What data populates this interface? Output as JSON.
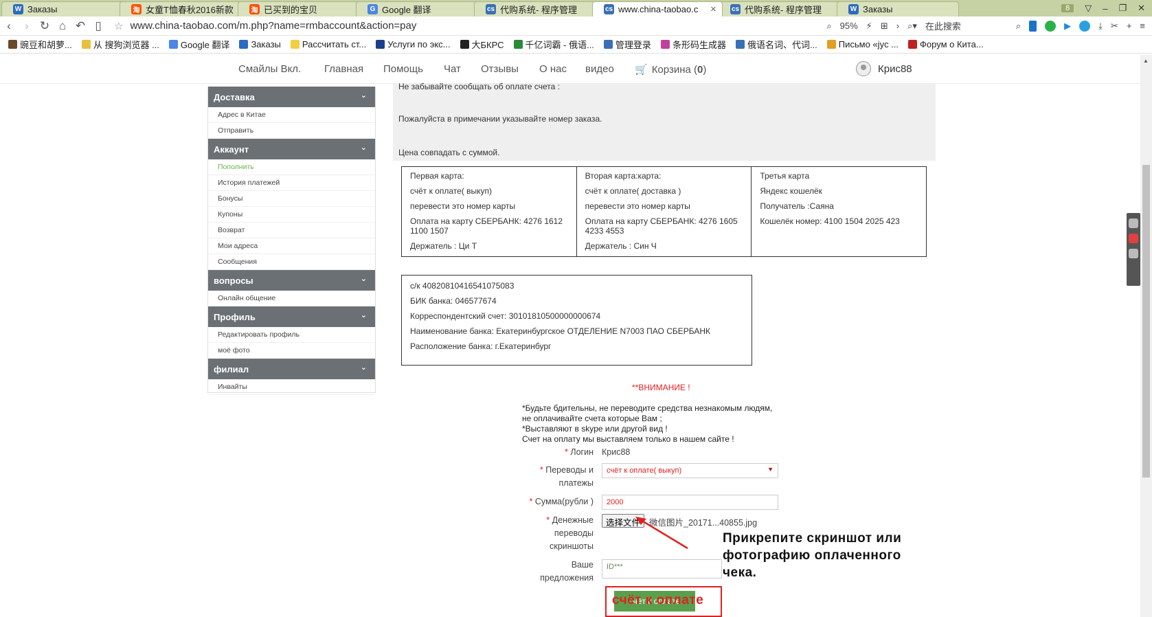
{
  "browser": {
    "tabs": [
      {
        "icon": "W",
        "icon_color": "#2b6bc1",
        "title": "Заказы"
      },
      {
        "icon": "淘",
        "icon_color": "#ff5000",
        "title": "女童T恤春秋2016新款"
      },
      {
        "icon": "淘",
        "icon_color": "#ff5000",
        "title": "已买到的宝贝"
      },
      {
        "icon": "G",
        "icon_color": "#4a86e8",
        "title": "Google 翻译"
      },
      {
        "icon": "cs",
        "icon_color": "#3a6fb5",
        "title": "代购系统- 程序管理"
      },
      {
        "icon": "cs",
        "icon_color": "#3a6fb5",
        "title": "www.china-taobao.c"
      },
      {
        "icon": "cs",
        "icon_color": "#3a6fb5",
        "title": "代购系统- 程序管理"
      },
      {
        "icon": "W",
        "icon_color": "#2b6bc1",
        "title": "Заказы"
      }
    ],
    "active_tab": 5,
    "tab_count": "8",
    "url": "www.china-taobao.com/m.php?name=rmbaccount&action=pay",
    "zoom": "95%",
    "search_placeholder": "在此搜索",
    "bookmarks": [
      {
        "label": "豌豆和胡萝...",
        "color": "#6a4a2a"
      },
      {
        "label": "从 搜狗浏览器 ...",
        "color": "#e8c040"
      },
      {
        "label": "Google 翻译",
        "color": "#4a86e8"
      },
      {
        "label": "Заказы",
        "color": "#2b6bc1"
      },
      {
        "label": "Рассчитать ст...",
        "color": "#f0d040"
      },
      {
        "label": "Услуги по экс...",
        "color": "#1a3f8a"
      },
      {
        "label": "大БКРС",
        "color": "#222222"
      },
      {
        "label": "千亿词霸 - 俄语...",
        "color": "#2a8a3a"
      },
      {
        "label": "管理登录",
        "color": "#3a6fb5"
      },
      {
        "label": "条形码生成器",
        "color": "#c040a0"
      },
      {
        "label": "俄语名词、代词...",
        "color": "#3a6fb5"
      },
      {
        "label": "Письмо «jyc ...",
        "color": "#e0a020"
      },
      {
        "label": "Форум о Кита...",
        "color": "#c02020"
      }
    ]
  },
  "sitenav": {
    "items": [
      "Смайлы Вкл.",
      "Главная",
      "Помощь",
      "Чат",
      "Отзывы",
      "О нас",
      "видео"
    ],
    "cart_label": "Корзина (",
    "cart_count": "0",
    "cart_close": ")",
    "username": "Крис88"
  },
  "sidebar": {
    "sections": [
      {
        "title": "Доставка",
        "items": [
          "Адрес в Китае",
          "Отправить"
        ]
      },
      {
        "title": "Аккаунт",
        "items": [
          "Пополнить",
          "История платежей",
          "Бонусы",
          "Купоны",
          "Возврат",
          "Мои адреса",
          "Сообщения"
        ]
      },
      {
        "title": "вопросы",
        "items": [
          "Онлайн общение"
        ]
      },
      {
        "title": "Профиль",
        "items": [
          "Редактировать профиль",
          "моё фото"
        ]
      },
      {
        "title": "филиал",
        "items": [
          "Инвайты"
        ]
      }
    ],
    "active_item": "Пополнить"
  },
  "notice": {
    "line1": "Не забывайте сообщать об оплате счета :",
    "line2": "Пожалуйста в примечании указывайте номер заказа.",
    "line3": "Цена совпадать с суммой."
  },
  "cards": [
    {
      "lines": [
        "Первая карта:",
        "счёт к оплате( выкуп)",
        "перевести это номер карты",
        "Оплата на карту СБЕРБАНК: 4276 1612 1100 1507",
        "Держатель : Ци Т"
      ]
    },
    {
      "lines": [
        "Вторая карта:карта:",
        "счёт к оплате( доставка )",
        "перевести это номер карты",
        "Оплата на карту СБЕРБАНК: 4276 1605 4233 4553",
        "Держатель : Син Ч"
      ]
    },
    {
      "lines": [
        "Третья карта",
        "Яндекс кошелёк",
        "Получатель :Саяна",
        "Кошелёк номер: 4100 1504 2025 423"
      ]
    }
  ],
  "bank": [
    "с/к 40820810416541075083",
    "БИК банка: 046577674",
    "Корреспондентский счет: 30101810500000000674",
    "Наименование банка: Екатеринбургское ОТДЕЛЕНИЕ N7003 ПАО СБЕРБАНК",
    "Расположение банка: г.Екатеринбург"
  ],
  "warning": {
    "title": "**ВНИМАНИЕ !",
    "lines": [
      "*Будьте бдительны, не переводите средства незнакомым людям,",
      "не оплачивайте счета которые Вам ;",
      "*Выставляют в skype или другой вид !",
      "Счет на оплату мы выставляем только в нашем сайте !"
    ]
  },
  "form": {
    "login_label": "Логин",
    "login_value": "Крис88",
    "transfer_label_1": "Переводы и",
    "transfer_label_2": "платежы",
    "transfer_value": "счёт к оплате( выкуп)",
    "amount_label": "Сумма(рубли )",
    "amount_value": "2000",
    "screenshot_label_1": "Денежные",
    "screenshot_label_2": "переводы",
    "screenshot_label_3": "скриншоты",
    "file_button": "选择文件",
    "file_name": "微信图片_20171...40855.jpg",
    "comment_label_1": "Ваше",
    "comment_label_2": "предложения",
    "comment_value": "ID***",
    "submit_label": "счёт к оплате",
    "required_mark": "*"
  },
  "annotation": {
    "text": "Прикрепите  скриншот или\nфотографию  оплаченного\nчека.",
    "overlay": "счёт к оплате"
  }
}
